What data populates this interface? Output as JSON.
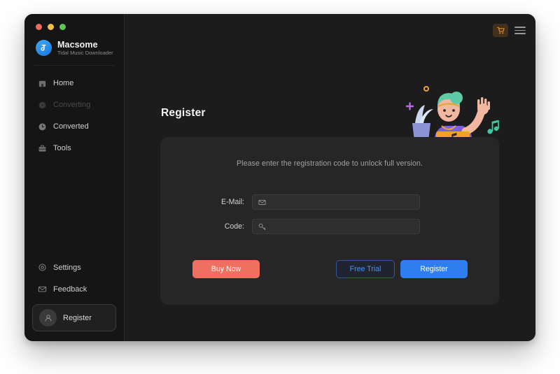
{
  "window": {
    "traffic_lights": [
      "close",
      "minimize",
      "maximize"
    ],
    "accent_blue": "#2f7ef0",
    "accent_coral": "#ef7060",
    "background": "#1c1c1c"
  },
  "sidebar": {
    "brand": {
      "title": "Macsome",
      "subtitle": "Tidal Music Downloader",
      "logo_icon": "macsome-logo-icon"
    },
    "main_items": [
      {
        "label": "Home",
        "icon": "home-icon",
        "state": "normal"
      },
      {
        "label": "Converting",
        "icon": "converting-icon",
        "state": "disabled"
      },
      {
        "label": "Converted",
        "icon": "converted-clock-icon",
        "state": "normal"
      },
      {
        "label": "Tools",
        "icon": "tools-icon",
        "state": "normal"
      }
    ],
    "bottom_items": [
      {
        "label": "Settings",
        "icon": "gear-icon"
      },
      {
        "label": "Feedback",
        "icon": "envelope-icon"
      }
    ],
    "register_item": {
      "label": "Register",
      "icon": "user-avatar-icon",
      "selected": true
    }
  },
  "titlebar": {
    "cart_icon": "shopping-cart-icon",
    "menu_icon": "hamburger-menu-icon"
  },
  "main": {
    "page_title": "Register",
    "illustration": "woman-waving-with-laptop-illustration",
    "card": {
      "hint": "Please enter the registration code to unlock full version.",
      "fields": [
        {
          "label": "E-Mail:",
          "icon": "envelope-icon",
          "value": "",
          "placeholder": ""
        },
        {
          "label": "Code:",
          "icon": "key-icon",
          "value": "",
          "placeholder": ""
        }
      ],
      "buttons": {
        "buy_now": "Buy Now",
        "free_trial": "Free Trial",
        "register": "Register"
      }
    }
  }
}
